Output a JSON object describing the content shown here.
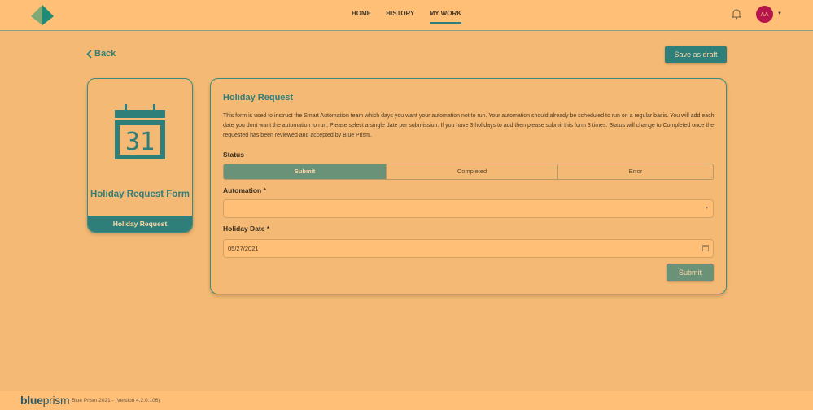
{
  "nav": {
    "items": [
      "HOME",
      "HISTORY",
      "MY WORK"
    ],
    "active": 2,
    "avatar": "AA"
  },
  "back_label": "Back",
  "save_draft_label": "Save as draft",
  "card": {
    "title": "Holiday Request Form",
    "footer": "Holiday Request",
    "icon_day": "31"
  },
  "form": {
    "title": "Holiday Request",
    "description": "This form is used to instruct the Smart Automation team which days you want your automation not to run. Your automation should already be scheduled to run on a regular basis. You will add each date you dont want the automation to run. Please select a single date per submission. If you have 3 holidays to add then please submit this form 3 times. Status will change to Completed once the requested has been reviewed and accepted by Blue Prism.",
    "status_label": "Status",
    "status_options": [
      "Submit",
      "Completed",
      "Error"
    ],
    "automation_label": "Automation *",
    "automation_value": "",
    "date_label": "Holiday Date *",
    "date_value": "05/27/2021",
    "submit_label": "Submit"
  },
  "footer": {
    "brand_a": "blue",
    "brand_b": "prism",
    "version": "Blue Prism 2021 - (Version 4.2.0.106)"
  },
  "colors": {
    "accent": "#2e7f7a",
    "header": "#ffbf77",
    "background": "#f4b974",
    "avatar": "#b5154a"
  }
}
